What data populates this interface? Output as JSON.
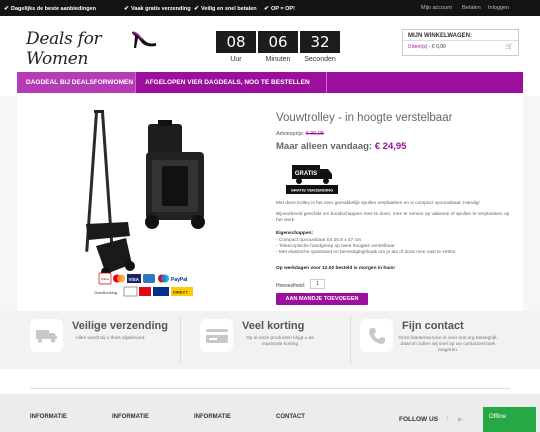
{
  "topbar": {
    "usps": [
      "Dagelijks de beste aanbiedingen",
      "Vaak gratis verzending",
      "Veilig en snel betalen",
      "OP = OP!"
    ],
    "account_links": [
      "Mijn account",
      "Betalen",
      "Inloggen"
    ]
  },
  "logo": {
    "text": "Deals for Women"
  },
  "countdown": {
    "hours": "08",
    "hours_label": "Uur",
    "minutes": "06",
    "minutes_label": "Minuten",
    "seconds": "32",
    "seconds_label": "Seconden"
  },
  "cart": {
    "title": "MIJN WINKELWAGEN:",
    "items": "0 item(s)",
    "total": "- € 0,00"
  },
  "nav": {
    "items": [
      "DAGDEAL BIJ DEALSFORWOMEN",
      "AFGELOPEN VIER DAGDEALS, NOG TE BESTELLEN"
    ]
  },
  "product": {
    "title": "Vouwtrolley - in hoogte verstelbaar",
    "old_price_label": "Adviesprijs:",
    "old_price": "€ 39,95",
    "now_label": "Maar alleen vandaag:",
    "now_price": "€ 24,95",
    "shipping_badge_top": "GRATIS",
    "shipping_badge_bottom": "GRATIS VERZENDING",
    "desc1": "Met deze trolley is het zeer gemakkelijk spullen verplaatsen en is compact opvouwbaar. Handig!",
    "desc2": "Bijvoorbeeld geschikt om boodschappen mee te doen, mee te nemen op vakantie of spullen te verplaatsen op het werk.",
    "features_title": "Eigenschappen:",
    "feature1": "- Compact opvouwbaar tot 25,5 x 47 cm",
    "feature2": "- Telescopische handgreep op twee hoogtes verstelbaar",
    "feature3": "- Met elastische spanband en bevestigingshaak om je tas of doos mee vast te zetten",
    "deadline": "Op werkdagen voor 12.00 besteld is morgen in huis!",
    "qty_label": "Hoeveelheid:",
    "qty": "1",
    "buy_label": "AAN MANDJE TOEVOEGEN",
    "pay_labels": [
      "iDEAL",
      "VISA",
      "PayPal",
      "OverBooking",
      "DIRECT"
    ]
  },
  "features": [
    {
      "title": "Veilige verzending",
      "desc": "Alles wordt bij u thuis afgeleverd"
    },
    {
      "title": "Veel korting",
      "desc": "Op al onze producten krijgt u de maximale korting"
    },
    {
      "title": "Fijn contact",
      "desc": "Onze klantenservice is voor ons erg belangrijk, daarom zullen wij snel op uw contactverzoek reageren."
    }
  ],
  "footer": {
    "headings": [
      "INFORMATIE",
      "INFORMATIE",
      "INFORMATIE",
      "CONTACT"
    ],
    "follow": "FOLLOW US",
    "chat": "Offline"
  },
  "colors": {
    "brand": "#9c0e9c",
    "dark": "#141414",
    "chat": "#28a745"
  }
}
